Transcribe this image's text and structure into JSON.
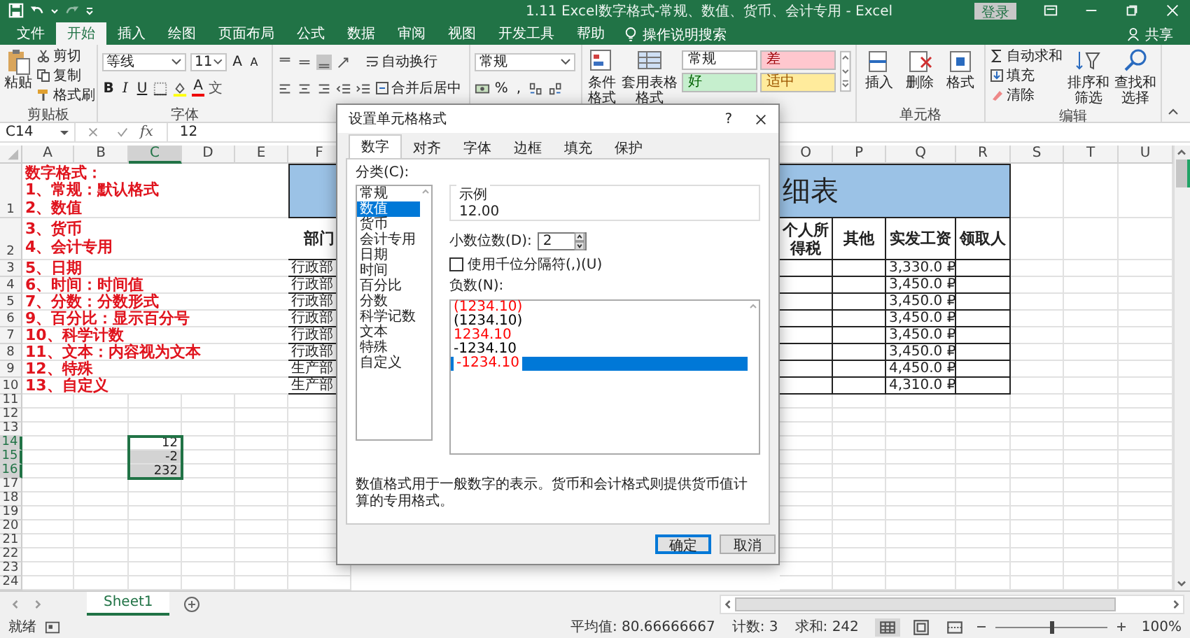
{
  "window": {
    "title": "1.11 Excel数字格式-常规、数值、货币、会计专用  -  Excel",
    "sign_in": "登录"
  },
  "ribbon_tabs": [
    {
      "label": "文件",
      "selected": false
    },
    {
      "label": "开始",
      "selected": true
    },
    {
      "label": "插入",
      "selected": false
    },
    {
      "label": "绘图",
      "selected": false
    },
    {
      "label": "页面布局",
      "selected": false
    },
    {
      "label": "公式",
      "selected": false
    },
    {
      "label": "数据",
      "selected": false
    },
    {
      "label": "审阅",
      "selected": false
    },
    {
      "label": "视图",
      "selected": false
    },
    {
      "label": "开发工具",
      "selected": false
    },
    {
      "label": "帮助",
      "selected": false
    }
  ],
  "tell_me": "操作说明搜索",
  "share": "共享",
  "ribbon": {
    "clipboard": {
      "paste": "粘贴",
      "cut": "剪切",
      "copy": "复制",
      "format_painter": "格式刷",
      "label": "剪贴板"
    },
    "font": {
      "name": "等线",
      "size": "11",
      "grow": "A",
      "shrink": "A",
      "bold": "B",
      "italic": "I",
      "underline": "U",
      "color_letter": "A",
      "phonetic": "文",
      "label": "字体"
    },
    "alignment": {
      "wrap_text": "自动换行",
      "merge_center": "合并后居中"
    },
    "number": {
      "format": "常规",
      "percent": "%",
      "comma": ","
    },
    "styles": {
      "conditional": "条件格式",
      "table_format": "套用表格格式",
      "gallery": [
        {
          "label": "常规",
          "color": "#ffffff"
        },
        {
          "label": "差",
          "color": "#ffc7ce"
        },
        {
          "label": "好",
          "color": "#c6efce"
        },
        {
          "label": "适中",
          "color": "#ffeb9c"
        }
      ]
    },
    "cells": {
      "insert": "插入",
      "delete": "删除",
      "format": "格式",
      "label": "单元格"
    },
    "editing": {
      "autosum": "自动求和",
      "fill": "填充",
      "clear": "清除",
      "sort_filter": "排序和筛选",
      "find_select": "查找和选择",
      "label": "编辑"
    }
  },
  "formula_bar": {
    "name_box": "C14",
    "function_label": "fx",
    "value": "12"
  },
  "sheet": {
    "columns_left": [
      {
        "label": "A",
        "selected": false
      },
      {
        "label": "B",
        "selected": false
      },
      {
        "label": "C",
        "selected": true
      },
      {
        "label": "D",
        "selected": false
      },
      {
        "label": "E",
        "selected": false
      },
      {
        "label": "F",
        "selected": false
      }
    ],
    "columns_right": [
      {
        "label": "O",
        "selected": false
      },
      {
        "label": "P",
        "selected": false
      },
      {
        "label": "Q",
        "selected": false
      },
      {
        "label": "R",
        "selected": false
      },
      {
        "label": "S",
        "selected": false
      },
      {
        "label": "T",
        "selected": false
      },
      {
        "label": "U",
        "selected": false
      }
    ],
    "rows": [
      {
        "label": "1",
        "selected": false
      },
      {
        "label": "2",
        "selected": false
      },
      {
        "label": "3",
        "selected": false
      },
      {
        "label": "4",
        "selected": false
      },
      {
        "label": "5",
        "selected": false
      },
      {
        "label": "6",
        "selected": false
      },
      {
        "label": "7",
        "selected": false
      },
      {
        "label": "8",
        "selected": false
      },
      {
        "label": "9",
        "selected": false
      },
      {
        "label": "10",
        "selected": false
      },
      {
        "label": "11",
        "selected": false
      },
      {
        "label": "12",
        "selected": false
      },
      {
        "label": "13",
        "selected": false
      },
      {
        "label": "14",
        "selected": true
      },
      {
        "label": "15",
        "selected": true
      },
      {
        "label": "16",
        "selected": true
      },
      {
        "label": "17",
        "selected": false
      },
      {
        "label": "18",
        "selected": false
      },
      {
        "label": "19",
        "selected": false
      },
      {
        "label": "20",
        "selected": false
      },
      {
        "label": "21",
        "selected": false
      },
      {
        "label": "22",
        "selected": false
      },
      {
        "label": "23",
        "selected": false
      },
      {
        "label": "24",
        "selected": false
      }
    ],
    "notes": [
      [
        "数字格式：",
        "1、常规：默认格式",
        "2、数值"
      ],
      [
        "3、货币",
        "4、会计专用"
      ],
      [
        "5、日期"
      ],
      [
        "6、时间：时间值"
      ],
      [
        "7、分数：分数形式"
      ],
      [
        "9、百分比：显示百分号"
      ],
      [
        "10、科学计数"
      ],
      [
        "11、文本：内容视为文本"
      ],
      [
        "12、特殊"
      ],
      [
        "13、自定义"
      ]
    ],
    "table": {
      "title": "细表",
      "headers": {
        "dept": "部门",
        "tax": "个人所得税",
        "other": "其他",
        "net_pay": "实发工资",
        "recipient": "领取人"
      },
      "rows": [
        {
          "dept": "行政部",
          "net_pay": "3,330.0 ₽"
        },
        {
          "dept": "行政部",
          "net_pay": "3,450.0 ₽"
        },
        {
          "dept": "行政部",
          "net_pay": "3,450.0 ₽"
        },
        {
          "dept": "行政部",
          "net_pay": "3,450.0 ₽"
        },
        {
          "dept": "行政部",
          "net_pay": "3,450.0 ₽"
        },
        {
          "dept": "行政部",
          "net_pay": "3,450.0 ₽"
        },
        {
          "dept": "生产部",
          "net_pay": "4,450.0 ₽"
        },
        {
          "dept": "生产部",
          "net_pay": "4,310.0 ₽"
        }
      ]
    },
    "selection": [
      {
        "value": "12",
        "active": true
      },
      {
        "value": "-2",
        "active": false
      },
      {
        "value": "232",
        "active": false
      }
    ]
  },
  "dialog": {
    "title": "设置单元格格式",
    "help": "?",
    "tabs": [
      {
        "label": "数字",
        "selected": true
      },
      {
        "label": "对齐",
        "selected": false
      },
      {
        "label": "字体",
        "selected": false
      },
      {
        "label": "边框",
        "selected": false
      },
      {
        "label": "填充",
        "selected": false
      },
      {
        "label": "保护",
        "selected": false
      }
    ],
    "category_label": "分类(C):",
    "categories": [
      {
        "label": "常规",
        "selected": false
      },
      {
        "label": "数值",
        "selected": true
      },
      {
        "label": "货币",
        "selected": false
      },
      {
        "label": "会计专用",
        "selected": false
      },
      {
        "label": "日期",
        "selected": false
      },
      {
        "label": "时间",
        "selected": false
      },
      {
        "label": "百分比",
        "selected": false
      },
      {
        "label": "分数",
        "selected": false
      },
      {
        "label": "科学记数",
        "selected": false
      },
      {
        "label": "文本",
        "selected": false
      },
      {
        "label": "特殊",
        "selected": false
      },
      {
        "label": "自定义",
        "selected": false
      }
    ],
    "sample_label": "示例",
    "sample": "12.00",
    "decimals_label": "小数位数(D):",
    "decimals": "2",
    "thousands": {
      "label": "使用千位分隔符(,)(U)",
      "checked": false
    },
    "negative_label": "负数(N):",
    "negatives": [
      {
        "label": "(1234.10)",
        "color": "#ff0000",
        "selected": false
      },
      {
        "label": "(1234.10)",
        "color": "#000000",
        "selected": false
      },
      {
        "label": "1234.10",
        "color": "#ff0000",
        "selected": false
      },
      {
        "label": "-1234.10",
        "color": "#000000",
        "selected": false
      },
      {
        "label": "-1234.10",
        "color": "#ff0000",
        "selected": true
      }
    ],
    "description": "数值格式用于一般数字的表示。货币和会计格式则提供货币值计算的专用格式。",
    "ok": "确定",
    "cancel": "取消"
  },
  "sheet_tabs": [
    {
      "label": "Sheet1",
      "selected": true
    }
  ],
  "status_bar": {
    "mode": "就绪",
    "average": "平均值: 80.66666667",
    "count": "计数: 3",
    "sum": "求和: 242",
    "views": [
      {
        "kind": "normal",
        "selected": true
      },
      {
        "kind": "page_layout",
        "selected": false
      },
      {
        "kind": "page_break",
        "selected": false
      }
    ],
    "zoom": {
      "level": 0.5,
      "label": "100%"
    }
  }
}
